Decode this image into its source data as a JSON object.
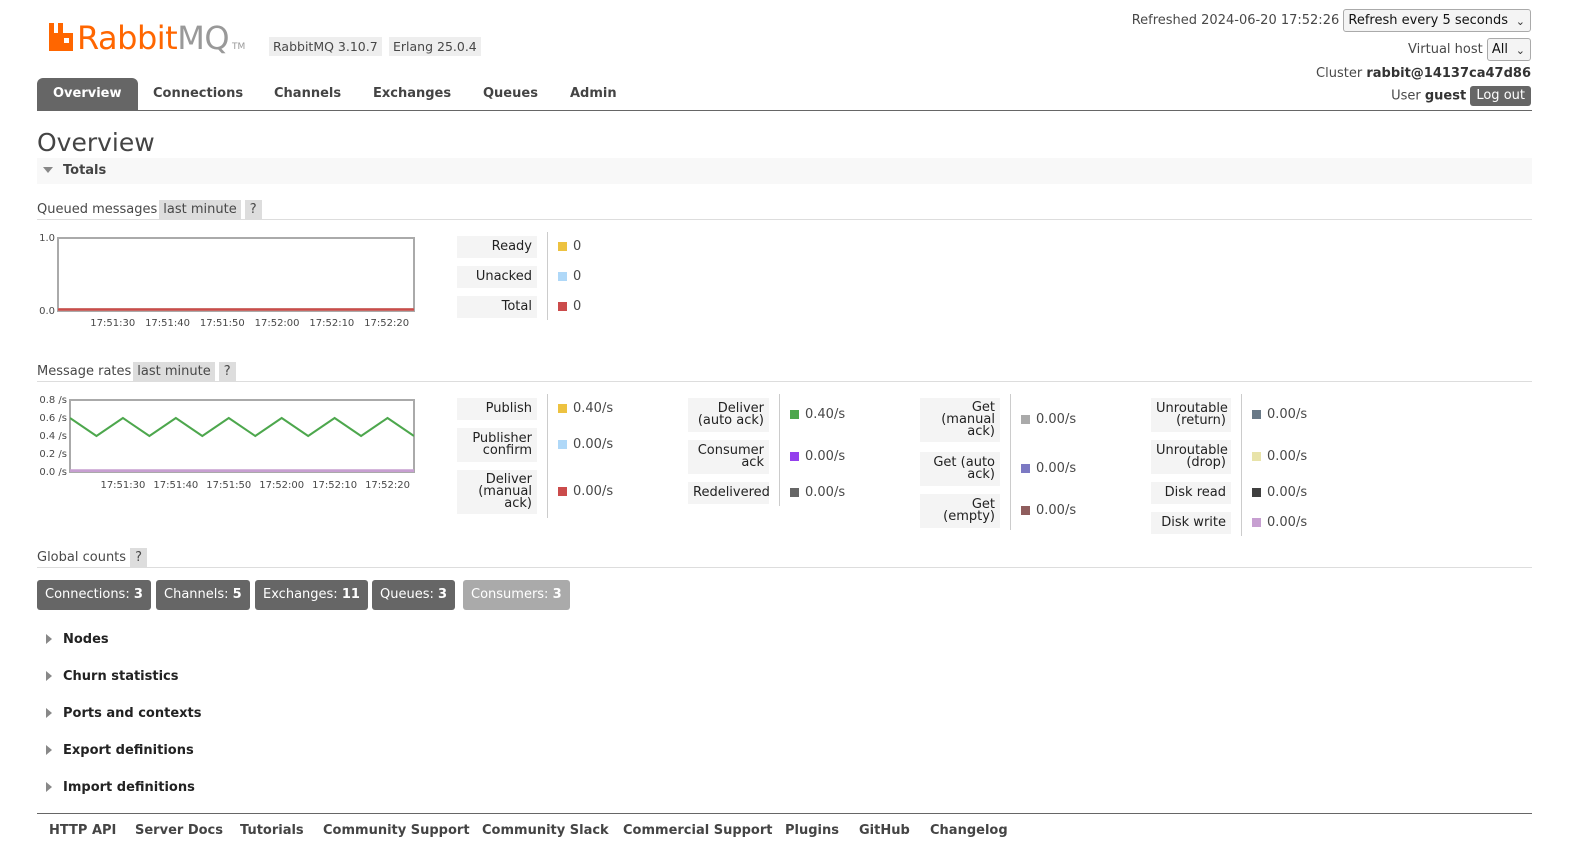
{
  "header": {
    "logo_word": "Rabbit",
    "logo_mq": "MQ",
    "logo_tm": "TM",
    "version": "RabbitMQ 3.10.7",
    "erlang": "Erlang 25.0.4",
    "refreshed_label": "Refreshed 2024-06-20 17:52:26",
    "refresh_select": "Refresh every 5 seconds",
    "vhost_label": "Virtual host",
    "vhost_select": "All",
    "cluster_label": "Cluster",
    "cluster_name": "rabbit@14137ca47d86",
    "user_label": "User",
    "user_name": "guest",
    "logout": "Log out",
    "brand_color": "#ff6600"
  },
  "tabs": [
    "Overview",
    "Connections",
    "Channels",
    "Exchanges",
    "Queues",
    "Admin"
  ],
  "page_title": "Overview",
  "totals": {
    "title": "Totals",
    "queued": {
      "label": "Queued messages",
      "range": "last minute",
      "help": "?",
      "legend": [
        {
          "label": "Ready",
          "value": "0",
          "color": "#edc240"
        },
        {
          "label": "Unacked",
          "value": "0",
          "color": "#afd8f8"
        },
        {
          "label": "Total",
          "value": "0",
          "color": "#cb4b4b"
        }
      ]
    },
    "rates": {
      "label": "Message rates",
      "range": "last minute",
      "help": "?",
      "legend": [
        {
          "label": "Publish",
          "value": "0.40/s",
          "color": "#edc240"
        },
        {
          "label": "Publisher confirm",
          "value": "0.00/s",
          "color": "#afd8f8"
        },
        {
          "label": "Deliver (manual ack)",
          "value": "0.00/s",
          "color": "#cb4b4b"
        },
        {
          "label": "Deliver (auto ack)",
          "value": "0.40/s",
          "color": "#4da74d"
        },
        {
          "label": "Consumer ack",
          "value": "0.00/s",
          "color": "#9440ed"
        },
        {
          "label": "Redelivered",
          "value": "0.00/s",
          "color": "#666666"
        },
        {
          "label": "Get (manual ack)",
          "value": "0.00/s",
          "color": "#aaaaaa"
        },
        {
          "label": "Get (auto ack)",
          "value": "0.00/s",
          "color": "#7c79c3"
        },
        {
          "label": "Get (empty)",
          "value": "0.00/s",
          "color": "#8f5d5d"
        },
        {
          "label": "Unroutable (return)",
          "value": "0.00/s",
          "color": "#697987"
        },
        {
          "label": "Unroutable (drop)",
          "value": "0.00/s",
          "color": "#e8e3a9"
        },
        {
          "label": "Disk read",
          "value": "0.00/s",
          "color": "#3f3f3f"
        },
        {
          "label": "Disk write",
          "value": "0.00/s",
          "color": "#c79fd1"
        }
      ]
    }
  },
  "chart_data": [
    {
      "type": "line",
      "x": [
        "17:51:30",
        "17:51:40",
        "17:51:50",
        "17:52:00",
        "17:52:10",
        "17:52:20"
      ],
      "ylim": [
        0,
        1.0
      ],
      "yticks": [
        "0.0",
        "1.0"
      ],
      "series": [
        {
          "name": "Ready",
          "values": [
            0,
            0,
            0,
            0,
            0,
            0
          ]
        },
        {
          "name": "Unacked",
          "values": [
            0,
            0,
            0,
            0,
            0,
            0
          ]
        },
        {
          "name": "Total",
          "values": [
            0,
            0,
            0,
            0,
            0,
            0
          ]
        }
      ]
    },
    {
      "type": "line",
      "x": [
        "17:51:30",
        "17:51:40",
        "17:51:50",
        "17:52:00",
        "17:52:10",
        "17:52:20"
      ],
      "ylim": [
        0,
        0.8
      ],
      "yticks": [
        "0.0 /s",
        "0.2 /s",
        "0.4 /s",
        "0.6 /s",
        "0.8 /s"
      ],
      "series": [
        {
          "name": "Deliver (auto ack)",
          "times": [
            -65,
            -60,
            -55,
            -50,
            -45,
            -40,
            -35,
            -30,
            -25,
            -20,
            -15,
            -10,
            -5,
            0
          ],
          "values": [
            0.6,
            0.4,
            0.6,
            0.4,
            0.6,
            0.4,
            0.6,
            0.4,
            0.6,
            0.4,
            0.6,
            0.4,
            0.6,
            0.4
          ]
        },
        {
          "name": "Publish",
          "times": [
            -65,
            0
          ],
          "values": [
            0,
            0
          ]
        }
      ]
    }
  ],
  "global_counts": {
    "label": "Global counts",
    "help": "?",
    "items": [
      {
        "label": "Connections:",
        "value": "3"
      },
      {
        "label": "Channels:",
        "value": "5"
      },
      {
        "label": "Exchanges:",
        "value": "11"
      },
      {
        "label": "Queues:",
        "value": "3"
      },
      {
        "label": "Consumers:",
        "value": "3"
      }
    ]
  },
  "sections": [
    "Nodes",
    "Churn statistics",
    "Ports and contexts",
    "Export definitions",
    "Import definitions"
  ],
  "footer": [
    "HTTP API",
    "Server Docs",
    "Tutorials",
    "Community Support",
    "Community Slack",
    "Commercial Support",
    "Plugins",
    "GitHub",
    "Changelog"
  ]
}
